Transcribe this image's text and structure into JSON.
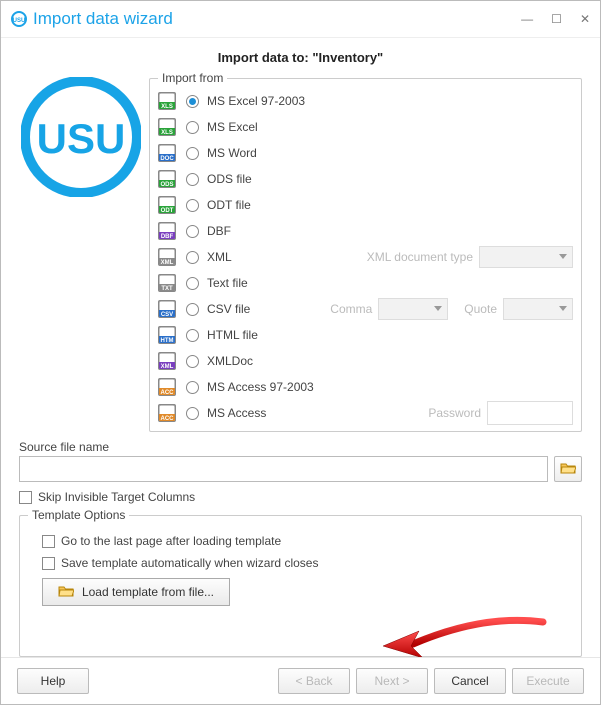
{
  "window": {
    "title": "Import data wizard"
  },
  "subtitle": "Import data to: \"Inventory\"",
  "import_from": {
    "legend": "Import from"
  },
  "formats": [
    {
      "key": "xls",
      "label": "MS Excel 97-2003",
      "checked": true,
      "icon_name": "xls-file-icon",
      "bg": "#2aa33a",
      "tag": "XLS"
    },
    {
      "key": "xlsx",
      "label": "MS Excel",
      "checked": false,
      "icon_name": "xlsx-file-icon",
      "bg": "#2aa33a",
      "tag": "XLS"
    },
    {
      "key": "doc",
      "label": "MS Word",
      "checked": false,
      "icon_name": "doc-file-icon",
      "bg": "#2a6fc9",
      "tag": "DOC"
    },
    {
      "key": "ods",
      "label": "ODS file",
      "checked": false,
      "icon_name": "ods-file-icon",
      "bg": "#2aa33a",
      "tag": "ODS"
    },
    {
      "key": "odt",
      "label": "ODT file",
      "checked": false,
      "icon_name": "odt-file-icon",
      "bg": "#2aa33a",
      "tag": "ODT"
    },
    {
      "key": "dbf",
      "label": "DBF",
      "checked": false,
      "icon_name": "dbf-file-icon",
      "bg": "#7a3fbf",
      "tag": "DBF"
    },
    {
      "key": "xml",
      "label": "XML",
      "checked": false,
      "icon_name": "xml-file-icon",
      "bg": "#8a8a8a",
      "tag": "XML",
      "extra": "xml"
    },
    {
      "key": "txt",
      "label": "Text file",
      "checked": false,
      "icon_name": "txt-file-icon",
      "bg": "#8a8a8a",
      "tag": "TXT"
    },
    {
      "key": "csv",
      "label": "CSV file",
      "checked": false,
      "icon_name": "csv-file-icon",
      "bg": "#2a6fc9",
      "tag": "CSV",
      "extra": "csv"
    },
    {
      "key": "html",
      "label": "HTML file",
      "checked": false,
      "icon_name": "html-file-icon",
      "bg": "#2a6fc9",
      "tag": "HTM"
    },
    {
      "key": "xmldoc",
      "label": "XMLDoc",
      "checked": false,
      "icon_name": "xmldoc-file-icon",
      "bg": "#7a3fbf",
      "tag": "XML"
    },
    {
      "key": "mdb97",
      "label": "MS Access 97-2003",
      "checked": false,
      "icon_name": "mdb97-file-icon",
      "bg": "#e08a2a",
      "tag": "ACC"
    },
    {
      "key": "mdb",
      "label": "MS Access",
      "checked": false,
      "icon_name": "mdb-file-icon",
      "bg": "#e08a2a",
      "tag": "ACC",
      "extra": "pw"
    }
  ],
  "extras": {
    "xml_label": "XML document type",
    "csv_comma_label": "Comma",
    "csv_quote_label": "Quote",
    "password_label": "Password"
  },
  "source": {
    "label": "Source file name",
    "value": ""
  },
  "skip_invisible": {
    "label": "Skip Invisible Target Columns",
    "checked": false
  },
  "template": {
    "legend": "Template Options",
    "go_last": {
      "label": "Go to the last page after loading template",
      "checked": false
    },
    "auto_save": {
      "label": "Save template automatically when wizard closes",
      "checked": false
    },
    "load_btn": "Load template from file..."
  },
  "footer": {
    "help": "Help",
    "back": "< Back",
    "next": "Next >",
    "cancel": "Cancel",
    "execute": "Execute"
  },
  "colors": {
    "accent": "#1ca3e8"
  }
}
